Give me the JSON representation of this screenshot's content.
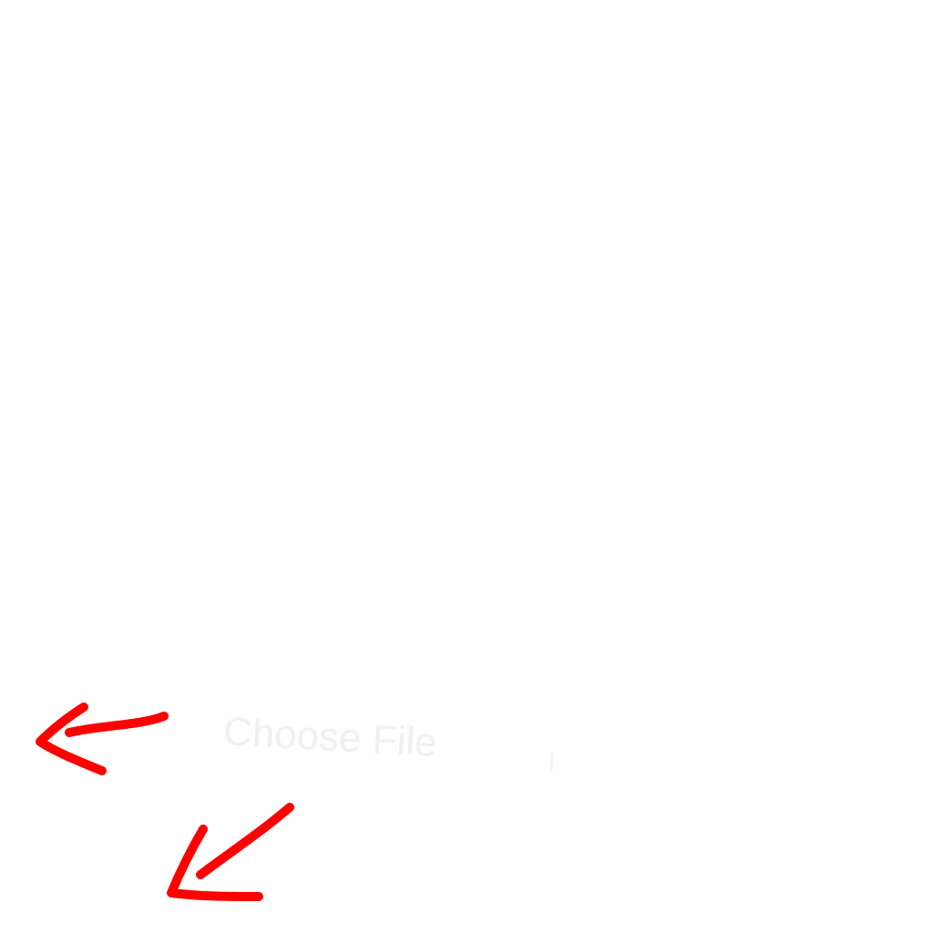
{
  "file_input": {
    "button_label": "Choose File",
    "text_color": "#f0f0f0"
  },
  "annotations": {
    "arrow_color": "#ff0000",
    "arrows": [
      {
        "name": "left-arrow-icon",
        "direction": "left"
      },
      {
        "name": "down-left-arrow-icon",
        "direction": "down-left"
      }
    ]
  }
}
